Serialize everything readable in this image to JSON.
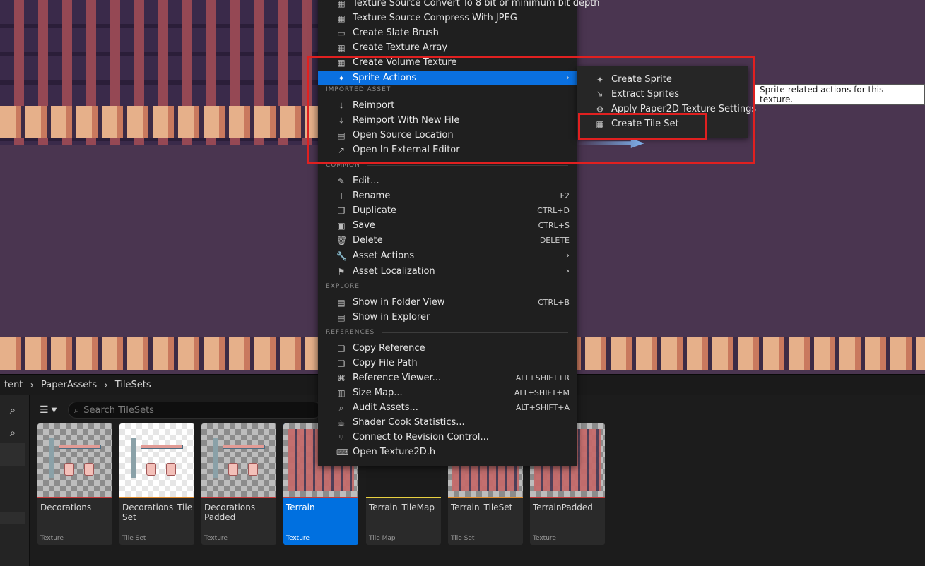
{
  "breadcrumb": [
    "tent",
    "PaperAssets",
    "TileSets"
  ],
  "search": {
    "placeholder": "Search TileSets"
  },
  "assets": [
    {
      "name": "Decorations",
      "kind": "Texture",
      "color": "#c63a3a"
    },
    {
      "name": "Decorations_Tile Set",
      "kind": "Tile Set",
      "color": "#e08a2a"
    },
    {
      "name": "Decorations Padded",
      "kind": "Texture",
      "color": "#c63a3a"
    },
    {
      "name": "Terrain",
      "kind": "Texture",
      "color": "#c63a3a",
      "selected": true
    },
    {
      "name": "Terrain_TileMap",
      "kind": "Tile Map",
      "color": "#e8d040"
    },
    {
      "name": "Terrain_TileSet",
      "kind": "Tile Set",
      "color": "#e08a2a"
    },
    {
      "name": "TerrainPadded",
      "kind": "Texture",
      "color": "#c63a3a"
    }
  ],
  "menu": {
    "top_items": [
      {
        "label": "Texture Source Convert To 8 bit or minimum bit depth",
        "icon": "checker-icon"
      },
      {
        "label": "Texture Source Compress With JPEG",
        "icon": "checker-icon"
      },
      {
        "label": "Create Slate Brush",
        "icon": "brush-icon"
      },
      {
        "label": "Create Texture Array",
        "icon": "checker-icon"
      },
      {
        "label": "Create Volume Texture",
        "icon": "checker-icon"
      },
      {
        "label": "Sprite Actions",
        "icon": "sprite-icon",
        "submenu": true,
        "highlighted": true
      }
    ],
    "sections": {
      "imported": "IMPORTED ASSET",
      "common": "COMMON",
      "explore": "EXPLORE",
      "references": "REFERENCES"
    },
    "imported_items": [
      {
        "label": "Reimport",
        "icon": "reimport-icon"
      },
      {
        "label": "Reimport With New File",
        "icon": "reimport-icon"
      },
      {
        "label": "Open Source Location",
        "icon": "folder-icon"
      },
      {
        "label": "Open In External Editor",
        "icon": "external-icon"
      }
    ],
    "common_items": [
      {
        "label": "Edit...",
        "icon": "pencil-icon",
        "shortcut": ""
      },
      {
        "label": "Rename",
        "icon": "rename-icon",
        "shortcut": "F2"
      },
      {
        "label": "Duplicate",
        "icon": "duplicate-icon",
        "shortcut": "CTRL+D"
      },
      {
        "label": "Save",
        "icon": "save-icon",
        "shortcut": "CTRL+S"
      },
      {
        "label": "Delete",
        "icon": "trash-icon",
        "shortcut": "DELETE"
      },
      {
        "label": "Asset Actions",
        "icon": "wrench-icon",
        "submenu": true
      },
      {
        "label": "Asset Localization",
        "icon": "flag-icon",
        "submenu": true
      }
    ],
    "explore_items": [
      {
        "label": "Show in Folder View",
        "icon": "folder-search-icon",
        "shortcut": "CTRL+B"
      },
      {
        "label": "Show in Explorer",
        "icon": "folder-search-icon",
        "shortcut": ""
      }
    ],
    "reference_items": [
      {
        "label": "Copy Reference",
        "icon": "copy-icon",
        "shortcut": ""
      },
      {
        "label": "Copy File Path",
        "icon": "copy-icon",
        "shortcut": ""
      },
      {
        "label": "Reference Viewer...",
        "icon": "reference-viewer-icon",
        "shortcut": "ALT+SHIFT+R"
      },
      {
        "label": "Size Map...",
        "icon": "size-map-icon",
        "shortcut": "ALT+SHIFT+M"
      },
      {
        "label": "Audit Assets...",
        "icon": "audit-icon",
        "shortcut": "ALT+SHIFT+A"
      },
      {
        "label": "Shader Cook Statistics...",
        "icon": "shader-icon",
        "shortcut": ""
      },
      {
        "label": "Connect to Revision Control...",
        "icon": "revision-control-icon",
        "shortcut": ""
      },
      {
        "label": "Open Texture2D.h",
        "icon": "code-file-icon",
        "shortcut": ""
      }
    ]
  },
  "submenu": {
    "items": [
      {
        "label": "Create Sprite",
        "icon": "sprite-icon"
      },
      {
        "label": "Extract Sprites",
        "icon": "extract-icon"
      },
      {
        "label": "Apply Paper2D Texture Settings",
        "icon": "settings-icon"
      },
      {
        "label": "Create Tile Set",
        "icon": "tileset-icon"
      }
    ]
  },
  "tooltip": "Sprite-related actions for this texture.",
  "colors": {
    "highlight": "#0a70e0",
    "annotation": "#e02020"
  }
}
